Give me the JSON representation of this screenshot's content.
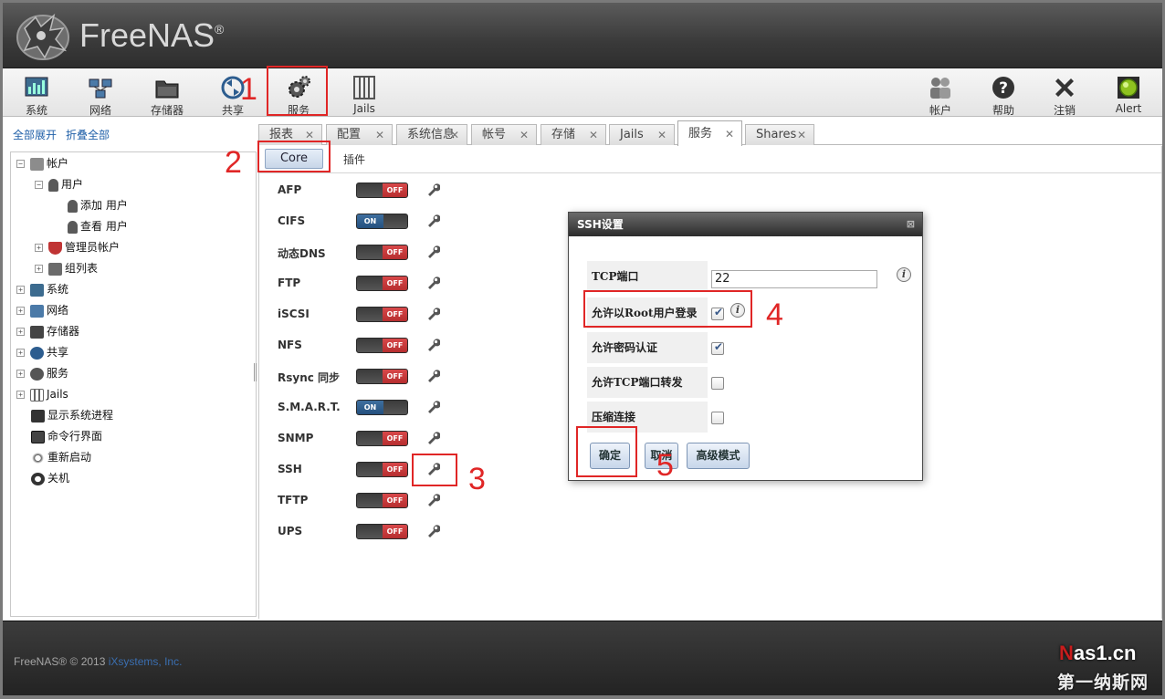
{
  "brand": {
    "name": "FreeNAS",
    "reg": "®"
  },
  "toolbar": {
    "left": [
      {
        "label": "系统",
        "icon": "system-icon"
      },
      {
        "label": "网络",
        "icon": "network-icon"
      },
      {
        "label": "存储器",
        "icon": "storage-icon"
      },
      {
        "label": "共享",
        "icon": "sharing-icon"
      },
      {
        "label": "服务",
        "icon": "services-icon"
      },
      {
        "label": "Jails",
        "icon": "jails-icon"
      }
    ],
    "right": [
      {
        "label": "帐户",
        "icon": "account-icon"
      },
      {
        "label": "帮助",
        "icon": "help-icon"
      },
      {
        "label": "注销",
        "icon": "logout-icon"
      },
      {
        "label": "Alert",
        "icon": "alert-icon"
      }
    ]
  },
  "tree": {
    "expand_all": "全部展开",
    "collapse_all": "折叠全部",
    "items": [
      {
        "label": "帐户"
      },
      {
        "label": "用户"
      },
      {
        "label": "添加 用户"
      },
      {
        "label": "查看 用户"
      },
      {
        "label": "管理员帐户"
      },
      {
        "label": "组列表"
      },
      {
        "label": "系统"
      },
      {
        "label": "网络"
      },
      {
        "label": "存储器"
      },
      {
        "label": "共享"
      },
      {
        "label": "服务"
      },
      {
        "label": "Jails"
      },
      {
        "label": "显示系统进程"
      },
      {
        "label": "命令行界面"
      },
      {
        "label": "重新启动"
      },
      {
        "label": "关机"
      }
    ]
  },
  "tabs": [
    {
      "label": "报表"
    },
    {
      "label": "配置"
    },
    {
      "label": "系统信息"
    },
    {
      "label": "帐号"
    },
    {
      "label": "存储"
    },
    {
      "label": "Jails"
    },
    {
      "label": "服务",
      "active": true
    },
    {
      "label": "Shares"
    }
  ],
  "subtabs": {
    "core": "Core",
    "plugins": "插件"
  },
  "switch": {
    "on": "ON",
    "off": "OFF"
  },
  "services": [
    {
      "name": "AFP",
      "state": "OFF"
    },
    {
      "name": "CIFS",
      "state": "ON"
    },
    {
      "name": "动态DNS",
      "state": "OFF"
    },
    {
      "name": "FTP",
      "state": "OFF"
    },
    {
      "name": "iSCSI",
      "state": "OFF"
    },
    {
      "name": "NFS",
      "state": "OFF"
    },
    {
      "name": "Rsync 同步",
      "state": "OFF"
    },
    {
      "name": "S.M.A.R.T.",
      "state": "ON"
    },
    {
      "name": "SNMP",
      "state": "OFF"
    },
    {
      "name": "SSH",
      "state": "OFF"
    },
    {
      "name": "TFTP",
      "state": "OFF"
    },
    {
      "name": "UPS",
      "state": "OFF"
    }
  ],
  "dialog": {
    "title": "SSH设置",
    "fields": {
      "tcp_port": {
        "label": "TCP端口",
        "value": "22"
      },
      "root_login": {
        "label": "允许以Root用户登录",
        "checked": true
      },
      "password_auth": {
        "label": "允许密码认证",
        "checked": true
      },
      "tcp_forward": {
        "label": "允许TCP端口转发",
        "checked": false
      },
      "compression": {
        "label": "压缩连接",
        "checked": false
      }
    },
    "buttons": {
      "ok": "确定",
      "cancel": "取消",
      "advanced": "高级模式"
    }
  },
  "footer": {
    "copyright": "FreeNAS® © 2013 ",
    "company": "iXsystems, Inc."
  },
  "watermark": {
    "line1a": "N",
    "line1b": "as1.cn",
    "line2": "第一纳斯网"
  },
  "annotations": [
    "1",
    "2",
    "3",
    "4",
    "5"
  ],
  "colors": {
    "annotation": "#e02626",
    "switch_off": "#c43a3b",
    "switch_on": "#2f5f8f",
    "link": "#1f5fa8"
  }
}
